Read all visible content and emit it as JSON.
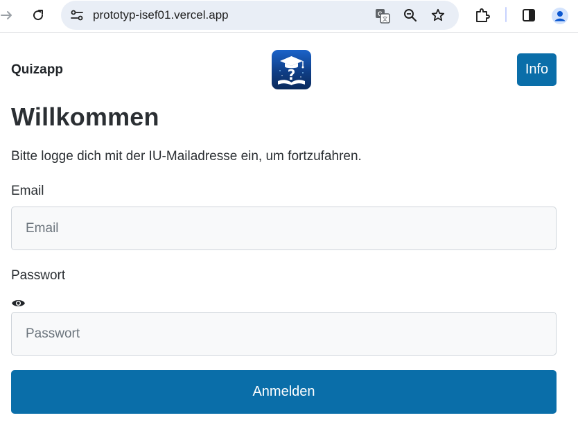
{
  "browser": {
    "url": "prototyp-isef01.vercel.app",
    "icons": [
      "forward-icon",
      "reload-icon",
      "site-settings-icon",
      "translate-icon",
      "zoom-icon",
      "bookmark-star-icon",
      "extensions-icon",
      "side-panel-icon",
      "profile-icon"
    ]
  },
  "header": {
    "brand": "Quizapp",
    "logo_icon": "graduation-cap-question-book-icon",
    "info_label": "Info"
  },
  "main": {
    "title": "Willkommen",
    "subtitle": "Bitte logge dich mit der IU-Mailadresse ein, um fortzufahren.",
    "email": {
      "label": "Email",
      "placeholder": "Email",
      "value": ""
    },
    "password": {
      "label": "Passwort",
      "placeholder": "Passwort",
      "value": "",
      "toggle_icon": "eye-icon"
    },
    "submit_label": "Anmelden"
  },
  "colors": {
    "primary": "#0a6ea9",
    "input_bg": "#f8f9fa",
    "input_border": "#ced4da",
    "text": "#212529",
    "omnibox_bg": "#e9eef6"
  }
}
